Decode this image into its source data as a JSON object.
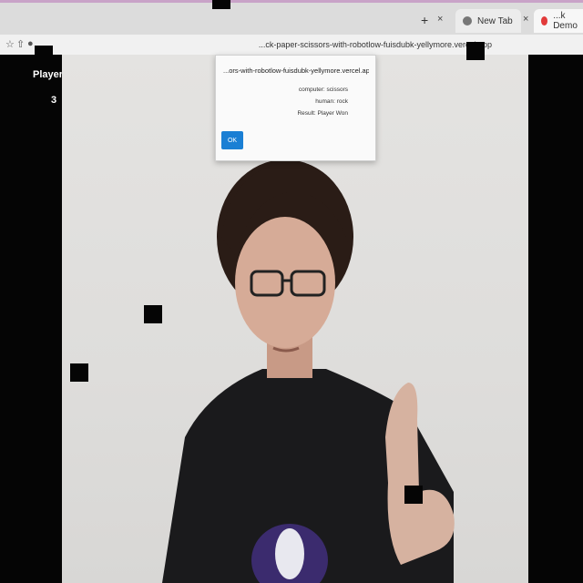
{
  "browser": {
    "tabs": [
      {
        "label": "New Tab",
        "icon": "globe-icon"
      },
      {
        "label": "...k Demo",
        "icon": "site-icon"
      }
    ],
    "new_tab_glyph": "+",
    "close_glyph": "×",
    "url": "...ck-paper-scissors-with-robotlow-fuisdubk-yellymore.vercel.app"
  },
  "game": {
    "player_label": "Player:",
    "score": "3"
  },
  "alert": {
    "title": "...ors-with-robotlow-fuisdubk-yellymore.vercel.app says",
    "computer": "computer: scissors",
    "human": "human: rock",
    "result": "Result: Player Won",
    "ok_label": "OK"
  },
  "colors": {
    "accent": "#1a7fd4",
    "page_bg": "#050505"
  }
}
